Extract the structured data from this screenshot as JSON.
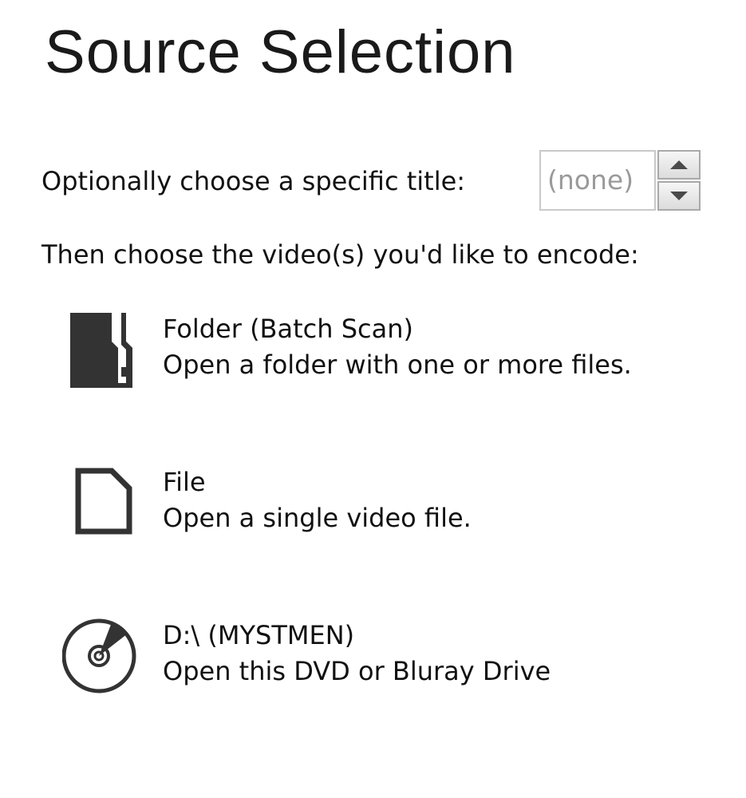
{
  "header": {
    "title": "Source Selection"
  },
  "title_selector": {
    "label": "Optionally choose a specific title:",
    "value": "(none)"
  },
  "instruction": "Then choose the video(s) you'd like to encode:",
  "options": [
    {
      "title": "Folder (Batch Scan)",
      "description": "Open a folder with one or more files.",
      "icon": "folder-icon"
    },
    {
      "title": "File",
      "description": "Open a single video file.",
      "icon": "file-icon"
    },
    {
      "title": "D:\\ (MYSTMEN)",
      "description": "Open this DVD or Bluray Drive",
      "icon": "disc-icon"
    }
  ],
  "colors": {
    "text": "#111111",
    "icon": "#333333",
    "placeholder": "#9a9a9a"
  }
}
